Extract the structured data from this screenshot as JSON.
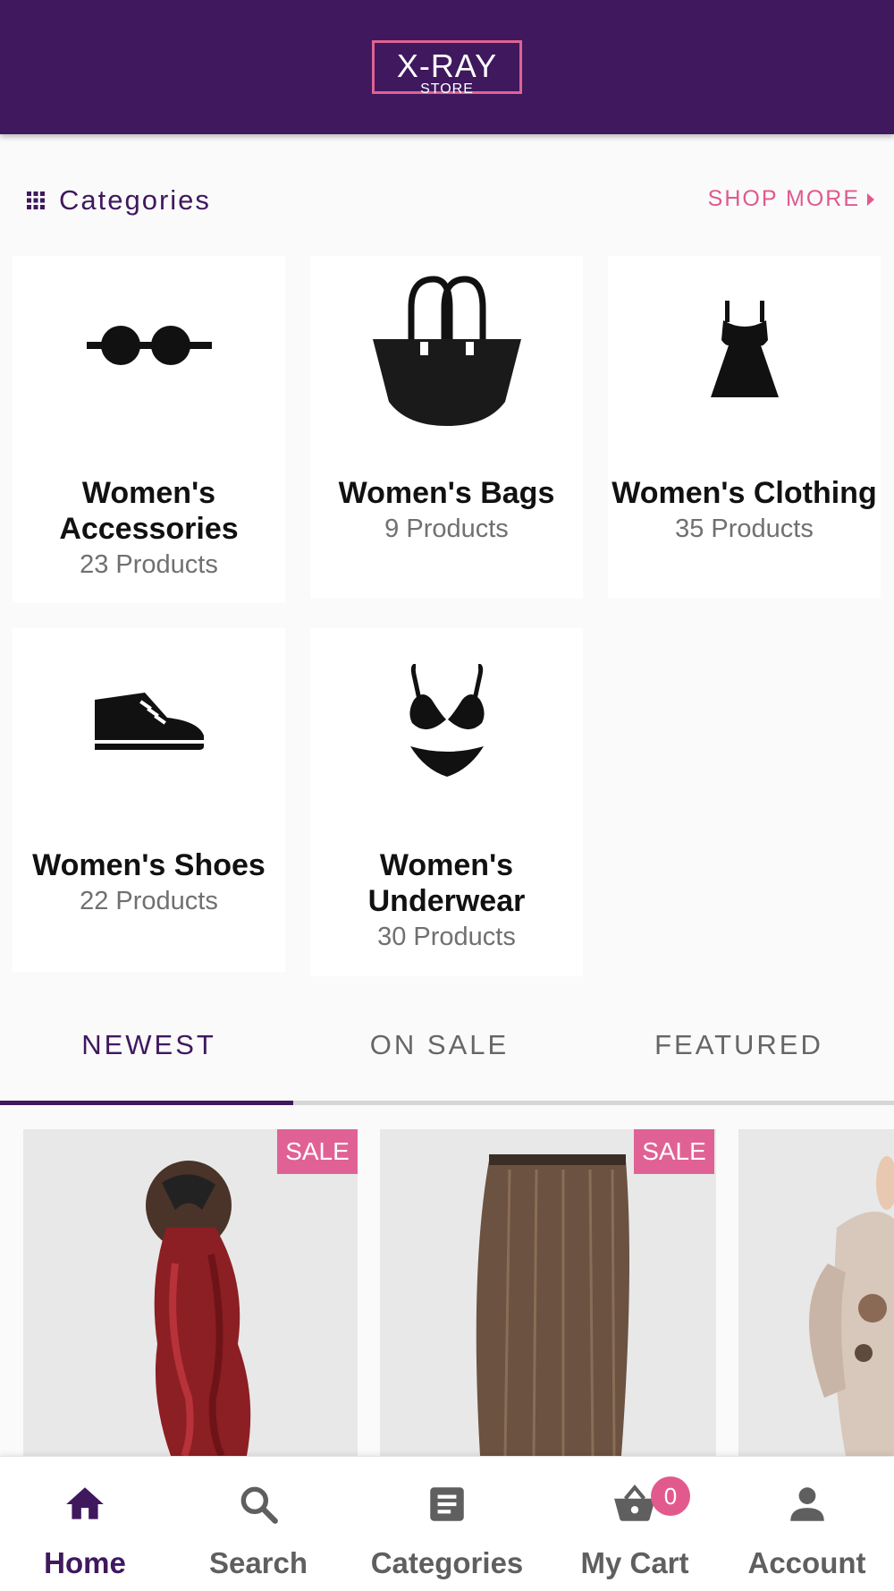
{
  "header": {
    "logo_main": "X-RAY",
    "logo_sub": "STORE"
  },
  "categories_section": {
    "title": "Categories",
    "shop_more": "SHOP MORE"
  },
  "categories": [
    {
      "name": "Women's Accessories",
      "count": "23 Products",
      "icon": "sunglasses-icon"
    },
    {
      "name": "Women's Bags",
      "count": "9 Products",
      "icon": "handbag-icon"
    },
    {
      "name": "Women's Clothing",
      "count": "35 Products",
      "icon": "dress-icon"
    },
    {
      "name": "Women's Shoes",
      "count": "22 Products",
      "icon": "sneaker-icon"
    },
    {
      "name": "Women's Underwear",
      "count": "30 Products",
      "icon": "bikini-icon"
    }
  ],
  "tabs": [
    {
      "label": "NEWEST",
      "active": true
    },
    {
      "label": "ON SALE",
      "active": false
    },
    {
      "label": "FEATURED",
      "active": false
    }
  ],
  "products": [
    {
      "badge": "SALE",
      "image": "red-ponytail-hair-extension"
    },
    {
      "badge": "SALE",
      "image": "brown-straight-hair-extension"
    },
    {
      "image": "printed-kimono-top"
    }
  ],
  "bottom_nav": [
    {
      "label": "Home",
      "icon": "home-icon",
      "active": true
    },
    {
      "label": "Search",
      "icon": "search-icon",
      "active": false
    },
    {
      "label": "Categories",
      "icon": "list-icon",
      "active": false
    },
    {
      "label": "My Cart",
      "icon": "basket-icon",
      "active": false,
      "badge": "0"
    },
    {
      "label": "Account",
      "icon": "person-icon",
      "active": false
    }
  ],
  "colors": {
    "brand": "#3f185e",
    "accent": "#e06294",
    "background": "#fafafa"
  }
}
